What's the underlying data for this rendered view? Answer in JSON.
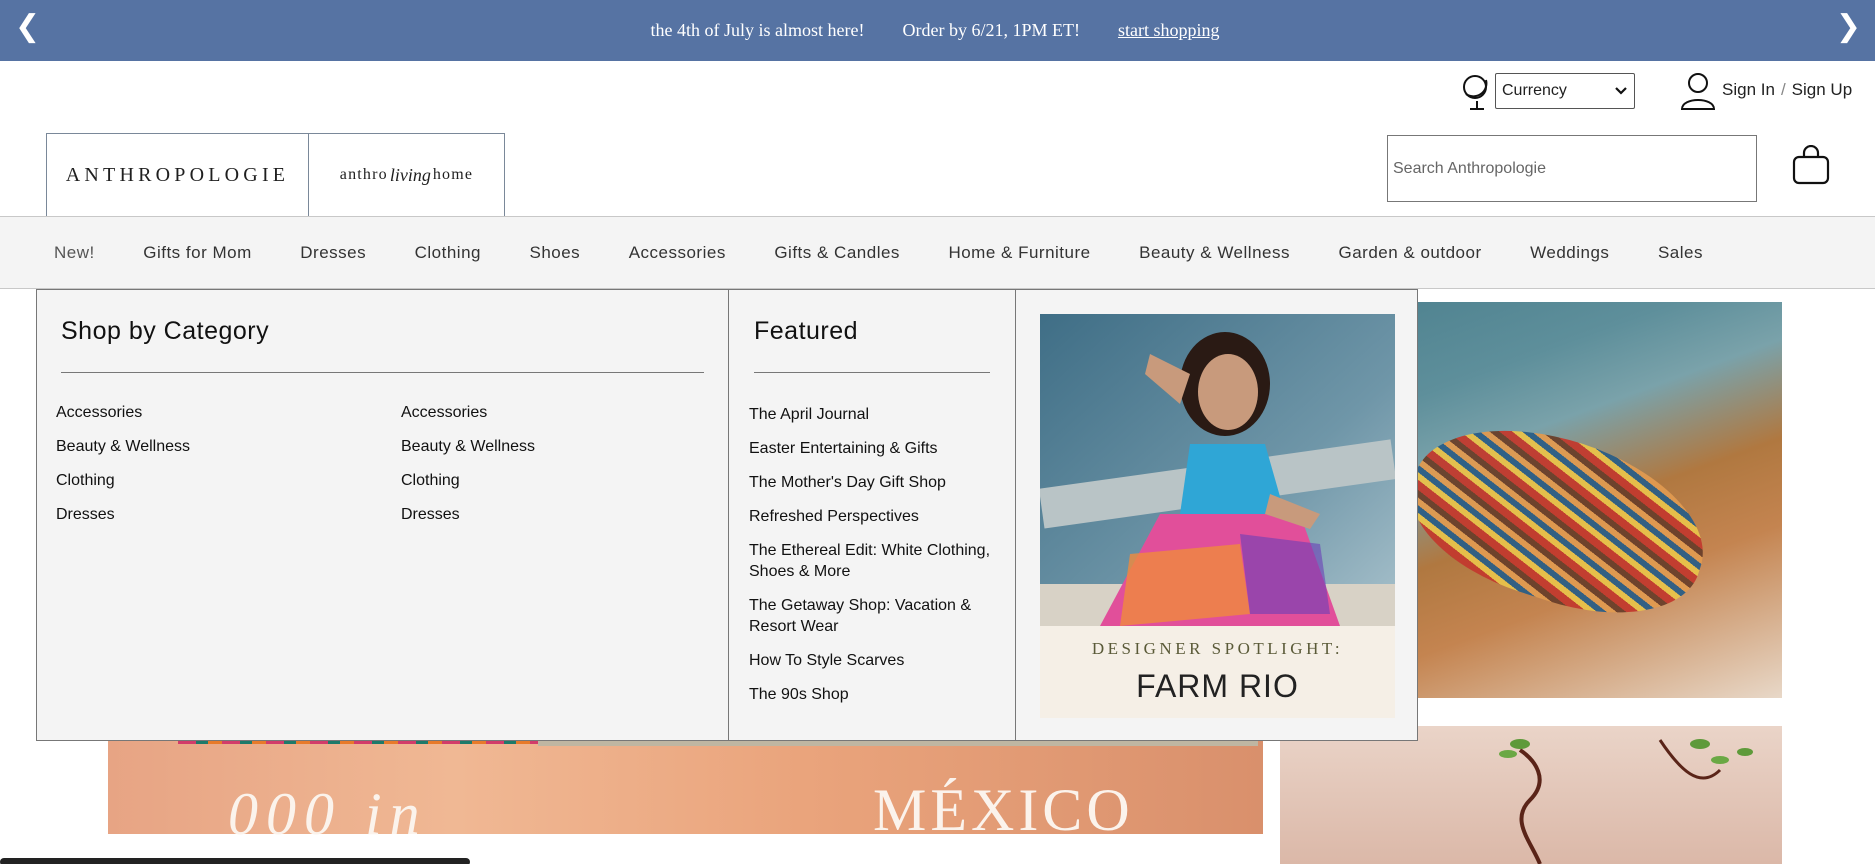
{
  "promo": {
    "message1": "the 4th of July is almost here!",
    "message2": "Order by 6/21, 1PM ET!",
    "cta": "start shopping",
    "prev_arrow": "❮",
    "next_arrow": "❯"
  },
  "utility": {
    "currency_label": "Currency",
    "sign_in": "Sign In",
    "separator": "/",
    "sign_up": "Sign Up"
  },
  "logo": {
    "primary": "ANTHROPOLOGIE",
    "secondary_left": "anthro",
    "secondary_script": "living",
    "secondary_right": "home"
  },
  "search": {
    "placeholder": "Search Anthropologie"
  },
  "nav": {
    "items": [
      "New!",
      "Gifts for Mom",
      "Dresses",
      "Clothing",
      "Shoes",
      "Accessories",
      "Gifts & Candles",
      "Home & Furniture",
      "Beauty & Wellness",
      "Garden & outdoor",
      "Weddings",
      "Sales"
    ]
  },
  "mega_menu": {
    "category_heading": "Shop by Category",
    "categories_col1": [
      "Accessories",
      "Beauty & Wellness",
      "Clothing",
      "Dresses"
    ],
    "categories_col2": [
      "Accessories",
      "Beauty & Wellness",
      "Clothing",
      "Dresses"
    ],
    "featured_heading": "Featured",
    "featured": [
      "The April Journal",
      "Easter Entertaining & Gifts",
      "The Mother's Day Gift Shop",
      "Refreshed Perspectives",
      "The Ethereal Edit: White Clothing, Shoes & More",
      "The Getaway Shop: Vacation & Resort Wear",
      "How To Style Scarves",
      "The 90s Shop"
    ],
    "promo_tagline": "DESIGNER SPOTLIGHT:",
    "promo_brand": "FARM RIO"
  },
  "hero": {
    "headline_word": "MÉXICO",
    "script_text": "000 in"
  },
  "colors": {
    "promo_bar": "#5673a3",
    "nav_bg": "#f4f4f4",
    "menu_bg": "#f4f4f4"
  },
  "icons": [
    "prev-arrow-icon",
    "next-arrow-icon",
    "globe-icon",
    "chevron-down-icon",
    "user-icon",
    "shopping-bag-icon"
  ]
}
